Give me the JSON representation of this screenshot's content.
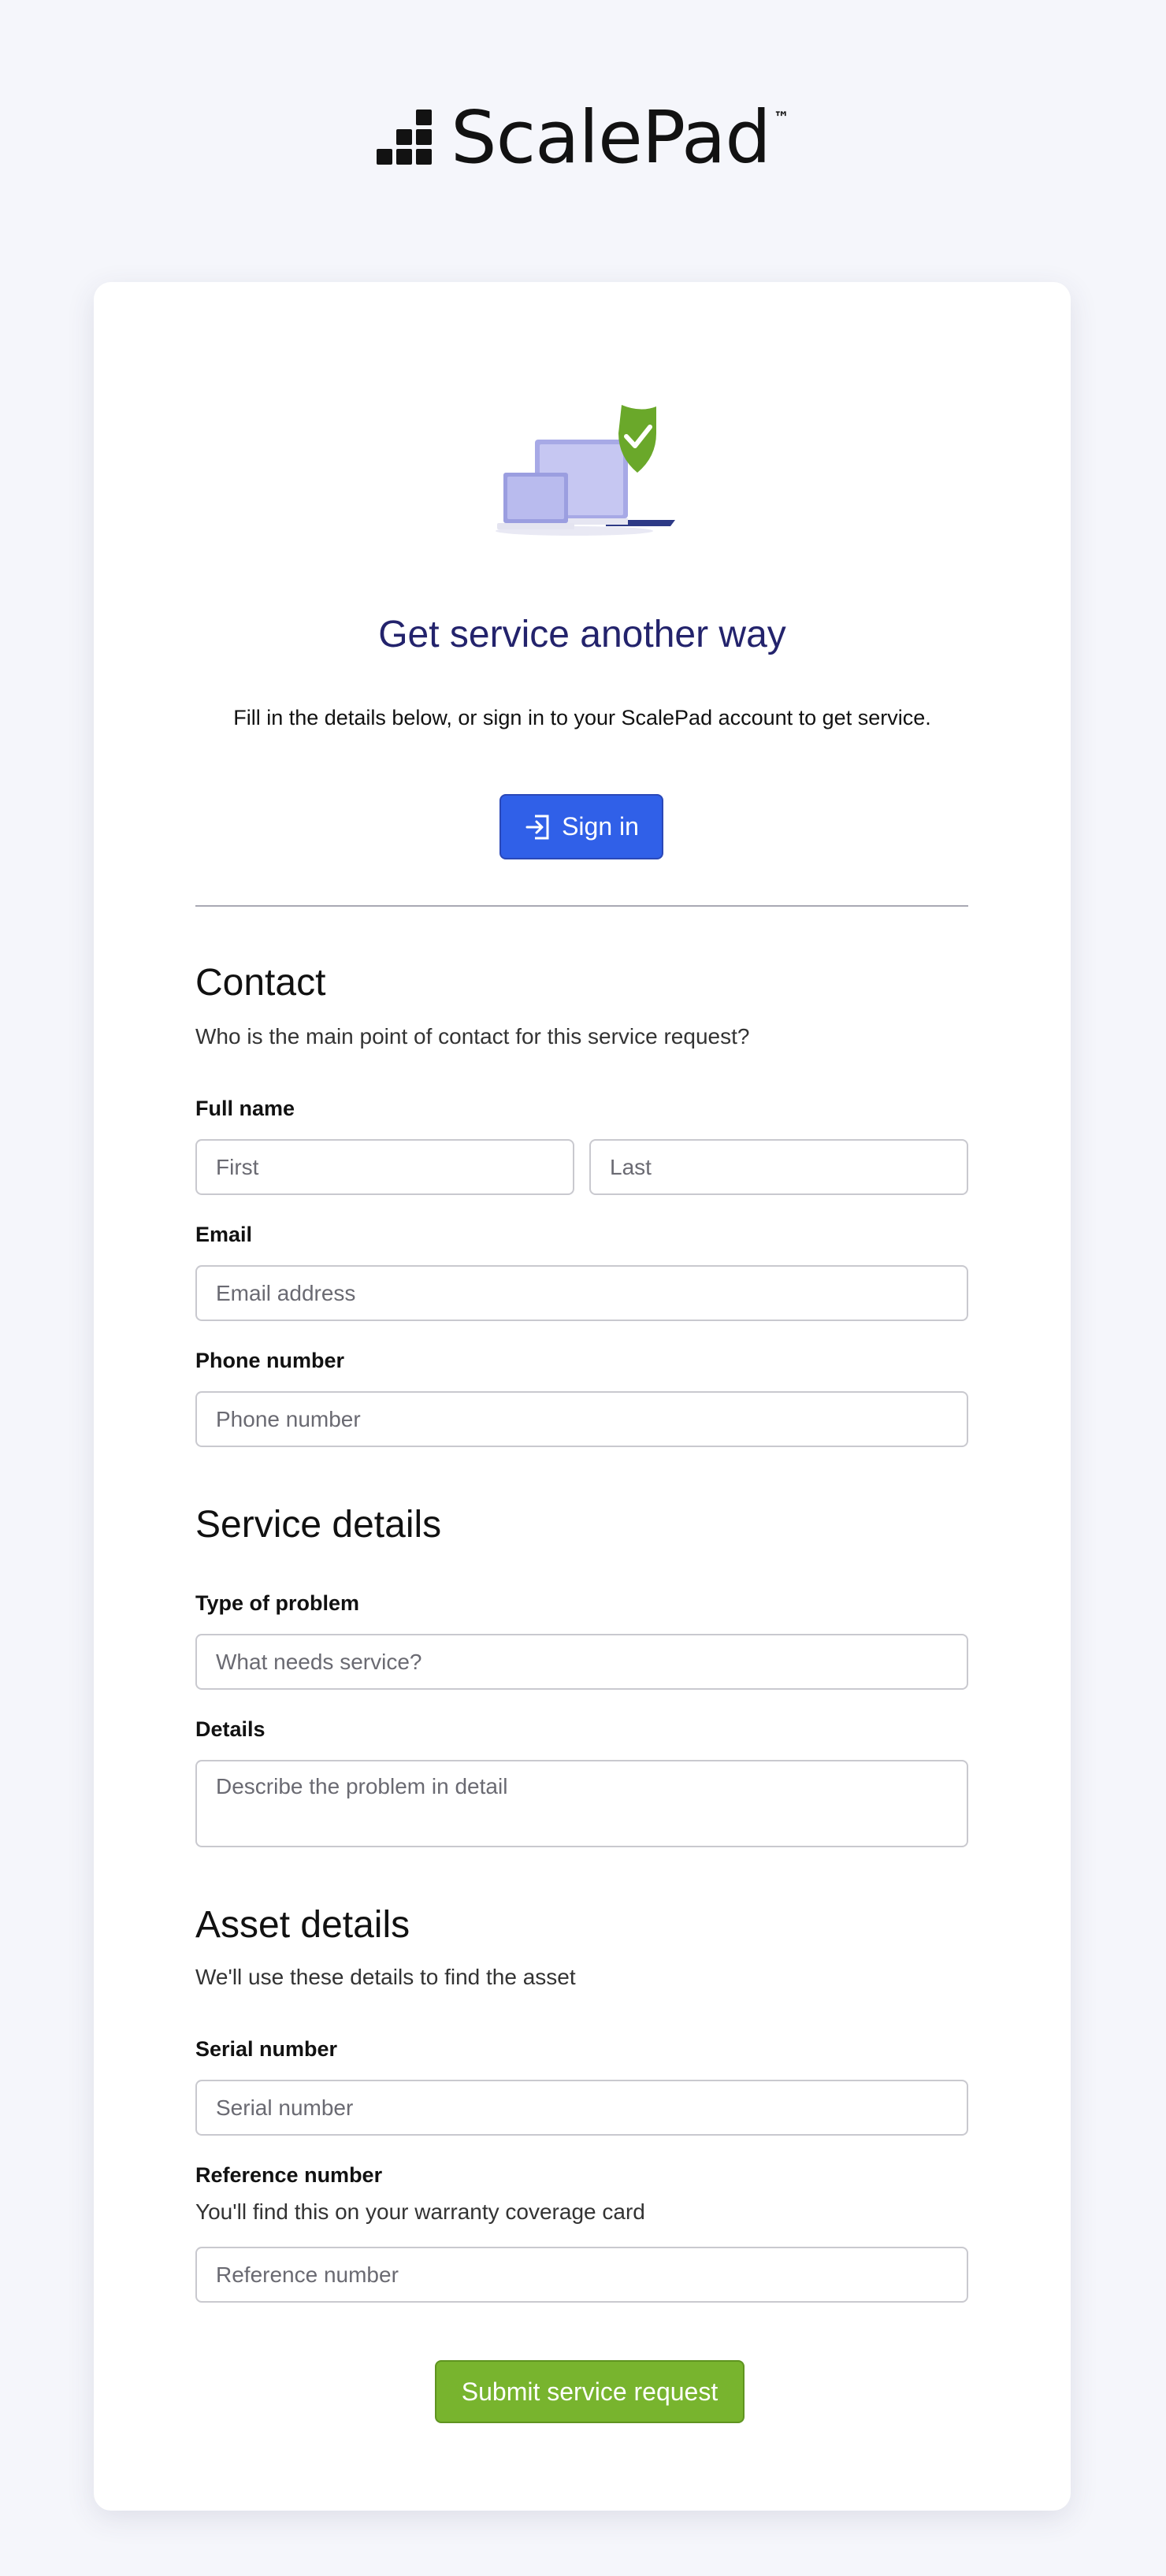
{
  "brand": {
    "name": "ScalePad",
    "tm": "™"
  },
  "hero": {
    "title": "Get service another way",
    "subtitle": "Fill in the details below, or sign in to your ScalePad account to get service.",
    "signin_label": "Sign in"
  },
  "contact": {
    "title": "Contact",
    "description": "Who is the main point of contact for this service request?",
    "full_name_label": "Full name",
    "first_placeholder": "First",
    "last_placeholder": "Last",
    "email_label": "Email",
    "email_placeholder": "Email address",
    "phone_label": "Phone number",
    "phone_placeholder": "Phone number"
  },
  "service": {
    "title": "Service details",
    "problem_label": "Type of problem",
    "problem_placeholder": "What needs service?",
    "details_label": "Details",
    "details_placeholder": "Describe the problem in detail"
  },
  "asset": {
    "title": "Asset details",
    "description": "We'll use these details to find the asset",
    "serial_label": "Serial number",
    "serial_placeholder": "Serial number",
    "reference_label": "Reference number",
    "reference_help": "You'll find this on your warranty coverage card",
    "reference_placeholder": "Reference number"
  },
  "submit_label": "Submit service request",
  "colors": {
    "background": "#f5f6fb",
    "title": "#23236c",
    "signin": "#3060e8",
    "submit": "#78b42e",
    "shield": "#6aa82a"
  }
}
